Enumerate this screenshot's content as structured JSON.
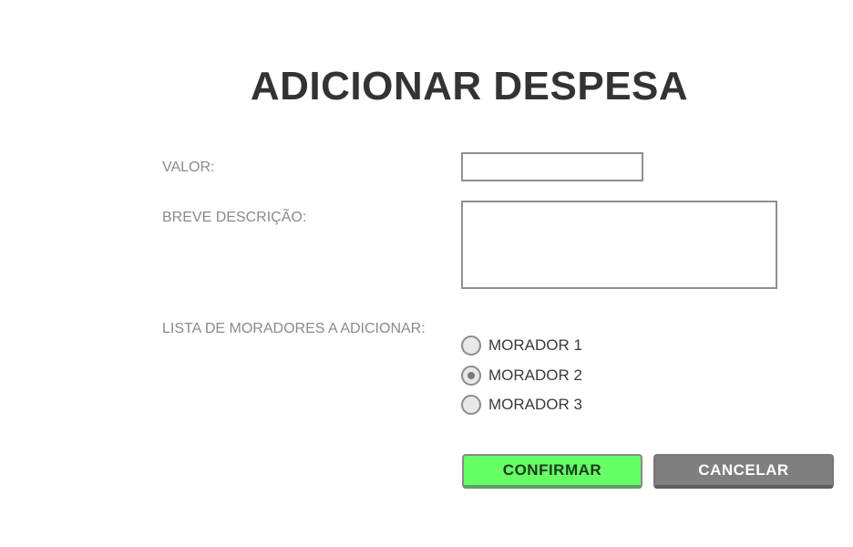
{
  "page": {
    "title": "ADICIONAR DESPESA"
  },
  "form": {
    "valor_label": "VALOR:",
    "valor_value": "",
    "descricao_label": "BREVE DESCRIÇÃO:",
    "descricao_value": "",
    "moradores_label": "LISTA DE MORADORES A ADICIONAR:",
    "moradores": [
      {
        "label": "MORADOR 1",
        "selected": false
      },
      {
        "label": "MORADOR 2",
        "selected": true
      },
      {
        "label": "MORADOR 3",
        "selected": false
      }
    ]
  },
  "actions": {
    "confirm_label": "CONFIRMAR",
    "cancel_label": "CANCELAR"
  },
  "colors": {
    "confirm_bg": "#66ff66",
    "cancel_bg": "#7f7f7f",
    "title": "#333333",
    "label": "#8a8a8a"
  }
}
